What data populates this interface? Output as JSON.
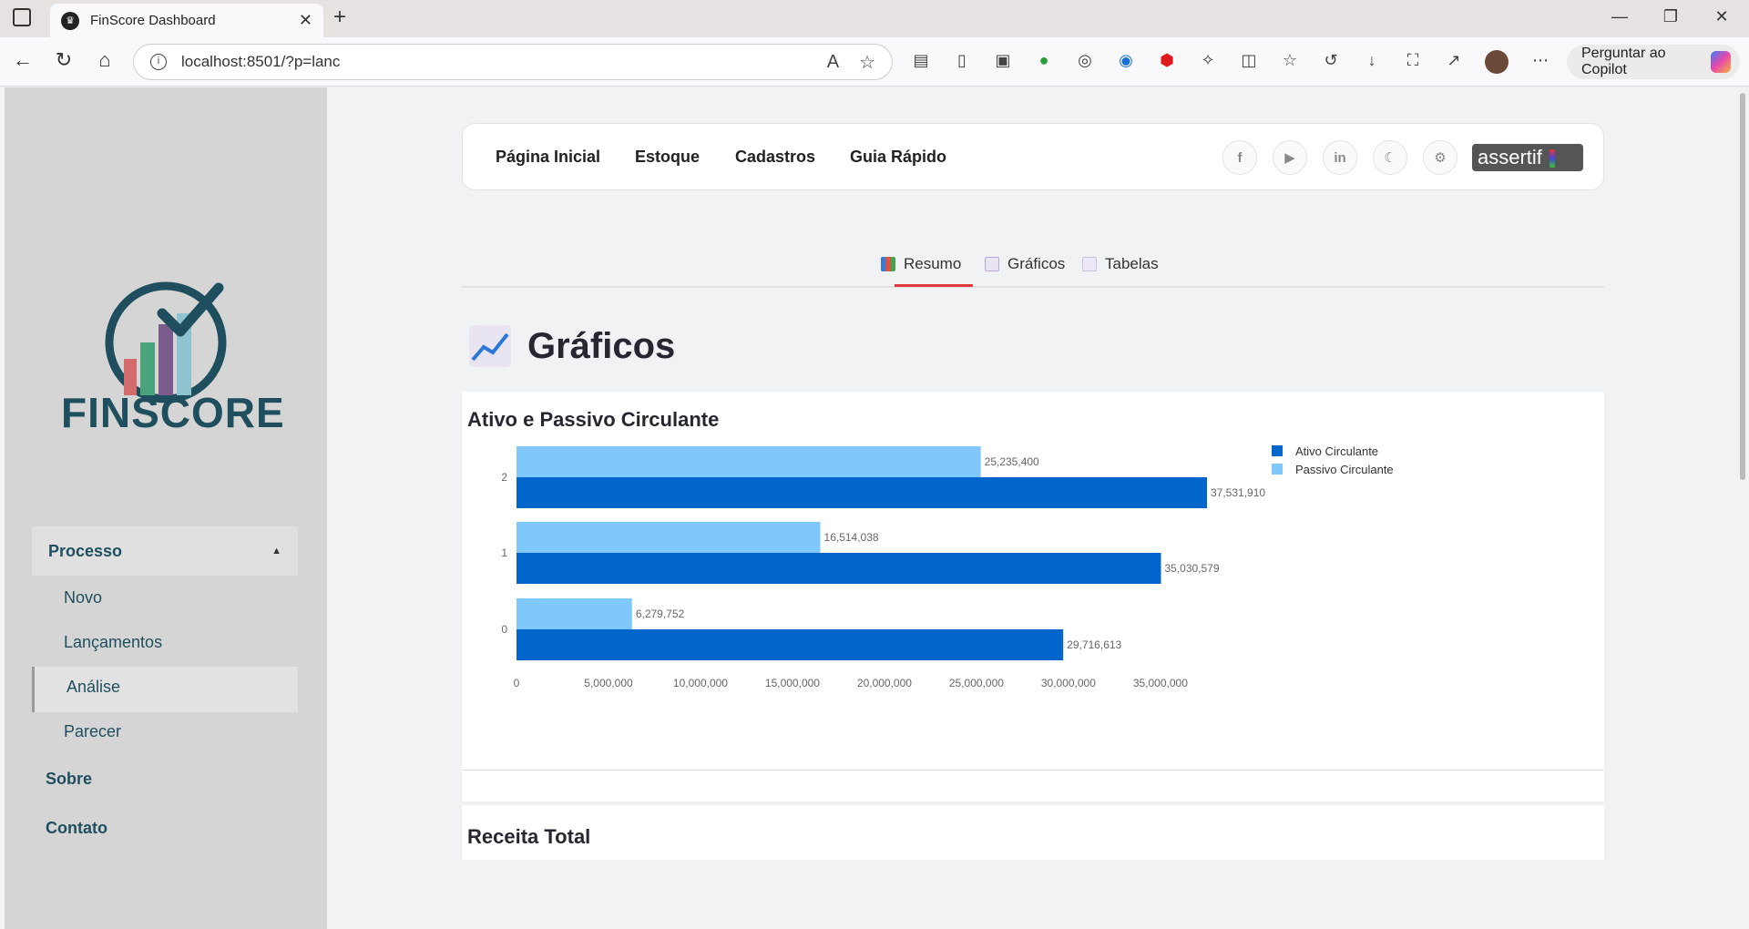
{
  "browser": {
    "tab_title": "FinScore Dashboard",
    "url": "localhost:8501/?p=lanc",
    "copilot_label": "Perguntar ao Copilot"
  },
  "sidebar": {
    "logo_text": "FINSCORE",
    "group_label": "Processo",
    "items": [
      "Novo",
      "Lançamentos",
      "Análise",
      "Parecer"
    ],
    "active_item": "Análise",
    "sobre": "Sobre",
    "contato": "Contato"
  },
  "topnav": {
    "links": [
      "Página Inicial",
      "Estoque",
      "Cadastros",
      "Guia Rápido"
    ],
    "social": [
      "facebook-icon",
      "youtube-icon",
      "linkedin-icon",
      "moon-icon",
      "gear-icon"
    ],
    "brand": "assertif"
  },
  "tabs": [
    {
      "label": "Resumo",
      "icon": "bar-chart-icon"
    },
    {
      "label": "Gráficos",
      "icon": "line-chart-icon",
      "active": true
    },
    {
      "label": "Tabelas",
      "icon": "document-icon"
    }
  ],
  "page": {
    "title": "Gráficos",
    "next_section": "Receita Total"
  },
  "colors": {
    "ativo": "#0066cc",
    "passivo": "#80c8fc",
    "accent": "#e0393e"
  },
  "chart_data": {
    "type": "bar",
    "orientation": "horizontal",
    "title": "Ativo e Passivo Circulante",
    "categories": [
      "0",
      "1",
      "2"
    ],
    "series": [
      {
        "name": "Ativo Circulante",
        "values": [
          29716613,
          35030579,
          37531910
        ]
      },
      {
        "name": "Passivo Circulante",
        "values": [
          6279752,
          16514038,
          25235400
        ]
      }
    ],
    "xticks": [
      "0",
      "5,000,000",
      "10,000,000",
      "15,000,000",
      "20,000,000",
      "25,000,000",
      "30,000,000",
      "35,000,000"
    ],
    "xlim": [
      0,
      37531910
    ],
    "legend": "top-right"
  }
}
